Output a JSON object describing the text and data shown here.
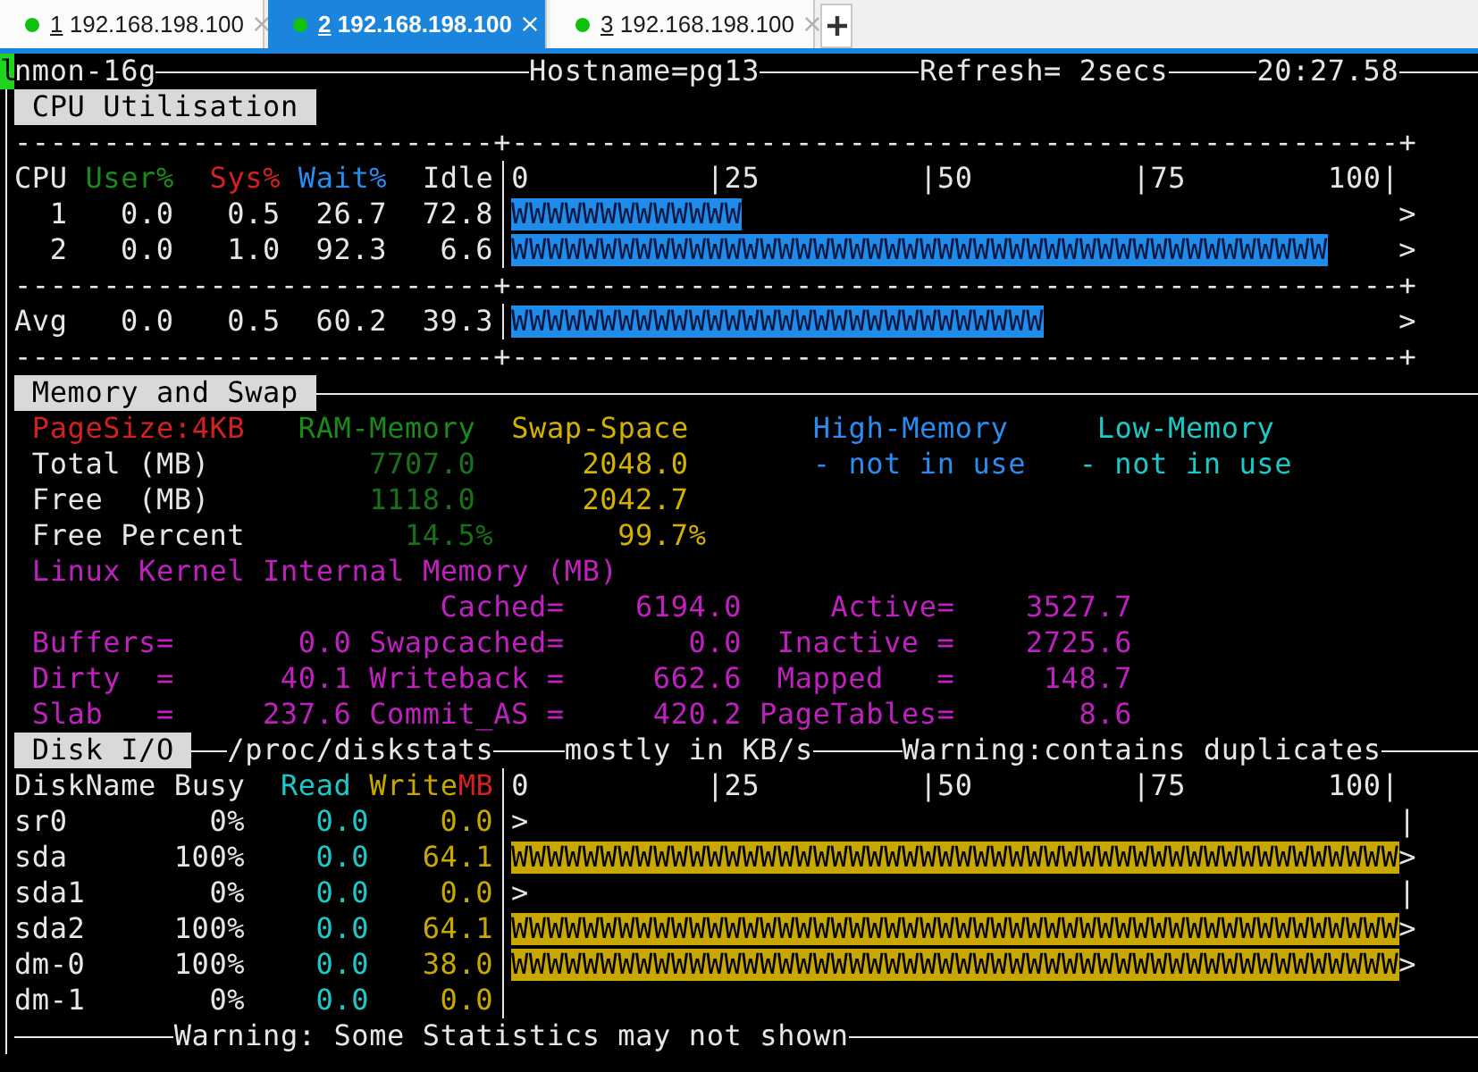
{
  "tabs": [
    {
      "number": "1",
      "label": "192.168.198.100",
      "selected": false
    },
    {
      "number": "2",
      "label": "192.168.198.100",
      "selected": true
    },
    {
      "number": "3",
      "label": "192.168.198.100",
      "selected": false
    }
  ],
  "terminal": {
    "cursor": "l",
    "program": "nmon-16g",
    "hostname": "Hostname=pg13",
    "refresh": "Refresh= 2secs",
    "time": "20:27.58",
    "cpu": {
      "title": "CPU Utilisation",
      "divider": "---------------------------+--------------------------------------------------+",
      "columns": [
        "CPU",
        "User%",
        "Sys%",
        "Wait%",
        "Idle"
      ],
      "scale": "0          |25         |50         |75        100|",
      "rows": [
        {
          "cpu": "1",
          "user": "0.0",
          "sys": "0.5",
          "wait": "26.7",
          "idle": "72.8",
          "bar": "WWWWWWWWWWWWW",
          "marker": ">"
        },
        {
          "cpu": "2",
          "user": "0.0",
          "sys": "1.0",
          "wait": "92.3",
          "idle": "6.6",
          "bar": "WWWWWWWWWWWWWWWWWWWWWWWWWWWWWWWWWWWWWWWWWWWWWW",
          "marker": ">"
        }
      ],
      "average": {
        "cpu": "Avg",
        "user": "0.0",
        "sys": "0.5",
        "wait": "60.2",
        "idle": "39.3",
        "bar": "WWWWWWWWWWWWWWWWWWWWWWWWWWWWWW",
        "marker": ">"
      }
    },
    "memory": {
      "title": "Memory and Swap",
      "page_size": "PageSize:4KB",
      "columns": [
        "RAM-Memory",
        "Swap-Space",
        "High-Memory",
        "Low-Memory"
      ],
      "rows": [
        {
          "kind": "value",
          "label": "Total (MB)",
          "ram": "7707.0",
          "swap": "2048.0",
          "high": "- not in use",
          "low": "- not in use"
        },
        {
          "kind": "value",
          "label": "Free  (MB)",
          "ram": "1118.0",
          "swap": "2042.7"
        },
        {
          "kind": "percent",
          "label": "Free Percent",
          "ram": "14.5%",
          "swap": "99.7%"
        }
      ],
      "kernel_title": "Linux Kernel Internal Memory (MB)",
      "kernel_rows": [
        {
          "middle": {
            "label": "Cached=",
            "value": "6194.0"
          },
          "right": {
            "label": "Active=",
            "value": "3527.7"
          }
        },
        {
          "left": {
            "label": "Buffers=",
            "value": "0.0"
          },
          "middle": {
            "label": "Swapcached=",
            "value": "0.0"
          },
          "right": {
            "label": "Inactive =",
            "value": "2725.6"
          }
        },
        {
          "left": {
            "label": "Dirty  =",
            "value": "40.1"
          },
          "middle": {
            "label": "Writeback =",
            "value": "662.6"
          },
          "right": {
            "label": "Mapped   =",
            "value": "148.7"
          }
        },
        {
          "left": {
            "label": "Slab   =",
            "value": "237.6"
          },
          "middle": {
            "label": "Commit_AS =",
            "value": "420.2"
          },
          "right": {
            "label": "PageTables=",
            "value": "8.6"
          }
        }
      ]
    },
    "disk": {
      "title": "Disk I/O",
      "source": "/proc/diskstats",
      "units": "mostly in KB/s",
      "warning": "Warning:contains duplicates",
      "columns": [
        "DiskName",
        "Busy",
        "Read",
        "Write",
        "MB"
      ],
      "scale": "0          |25         |50         |75        100|",
      "rows": [
        {
          "name": "sr0",
          "busy": "0%",
          "read": "0.0",
          "write": "0.0",
          "marker": ">",
          "edge": "|"
        },
        {
          "name": "sda",
          "busy": "100%",
          "read": "0.0",
          "write": "64.1",
          "bar": "WWWWWWWWWWWWWWWWWWWWWWWWWWWWWWWWWWWWWWWWWWWWWWWWWW",
          "marker": ">"
        },
        {
          "name": "sda1",
          "busy": "0%",
          "read": "0.0",
          "write": "0.0",
          "marker": ">",
          "edge": "|"
        },
        {
          "name": "sda2",
          "busy": "100%",
          "read": "0.0",
          "write": "64.1",
          "bar": "WWWWWWWWWWWWWWWWWWWWWWWWWWWWWWWWWWWWWWWWWWWWWWWWWW",
          "marker": ">"
        },
        {
          "name": "dm-0",
          "busy": "100%",
          "read": "0.0",
          "write": "38.0",
          "bar": "WWWWWWWWWWWWWWWWWWWWWWWWWWWWWWWWWWWWWWWWWWWWWWWWWW",
          "marker": ">"
        },
        {
          "name": "dm-1",
          "busy": "0%",
          "read": "0.0",
          "write": "0.0"
        }
      ],
      "footer": "Warning: Some Statistics may not shown"
    }
  }
}
